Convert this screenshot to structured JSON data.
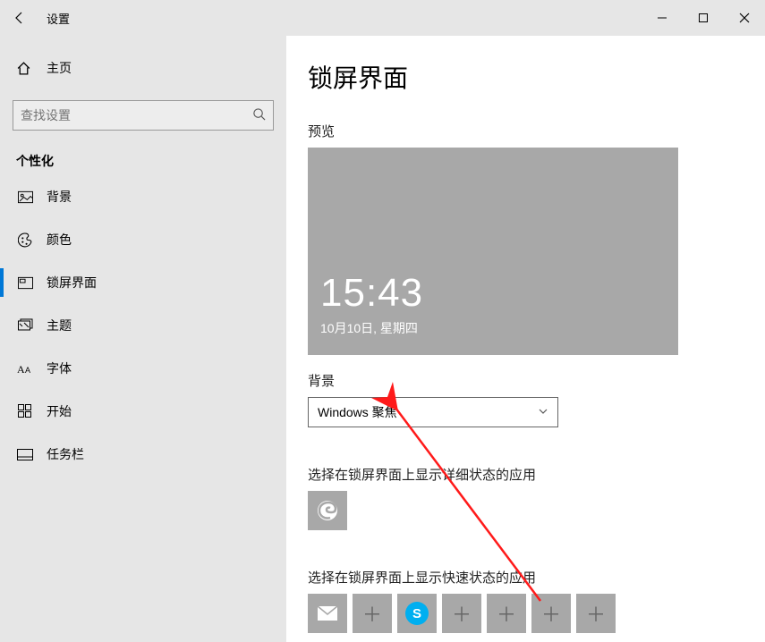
{
  "window": {
    "title": "设置"
  },
  "sidebar": {
    "home": "主页",
    "search_placeholder": "查找设置",
    "section": "个性化",
    "items": [
      {
        "label": "背景"
      },
      {
        "label": "颜色"
      },
      {
        "label": "锁屏界面"
      },
      {
        "label": "主题"
      },
      {
        "label": "字体"
      },
      {
        "label": "开始"
      },
      {
        "label": "任务栏"
      }
    ]
  },
  "main": {
    "title": "锁屏界面",
    "preview_label": "预览",
    "preview_time": "15:43",
    "preview_date": "10月10日, 星期四",
    "background_label": "背景",
    "background_value": "Windows 聚焦",
    "detail_app_label": "选择在锁屏界面上显示详细状态的应用",
    "quick_app_label": "选择在锁屏界面上显示快速状态的应用"
  }
}
